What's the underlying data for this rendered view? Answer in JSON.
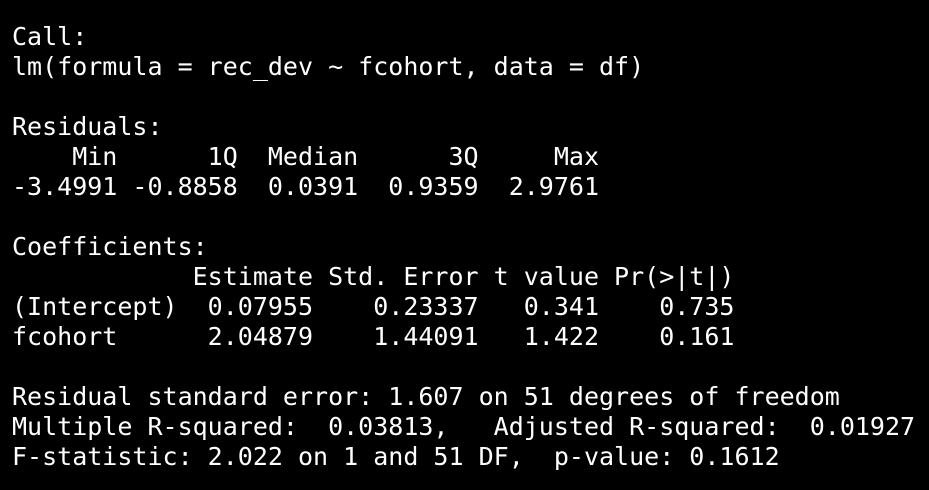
{
  "console": {
    "lines": [
      "Call:",
      "lm(formula = rec_dev ~ fcohort, data = df)",
      "",
      "Residuals:",
      "    Min      1Q  Median      3Q     Max ",
      "-3.4991 -0.8858  0.0391  0.9359  2.9761 ",
      "",
      "Coefficients:",
      "            Estimate Std. Error t value Pr(>|t|)",
      "(Intercept)  0.07955    0.23337   0.341    0.735",
      "fcohort      2.04879    1.44091   1.422    0.161",
      "",
      "Residual standard error: 1.607 on 51 degrees of freedom",
      "Multiple R-squared:  0.03813,\tAdjusted R-squared:  0.01927 ",
      "F-statistic: 2.022 on 1 and 51 DF,  p-value: 0.1612"
    ]
  },
  "colors": {
    "background": "#000000",
    "text": "#ffffff"
  }
}
